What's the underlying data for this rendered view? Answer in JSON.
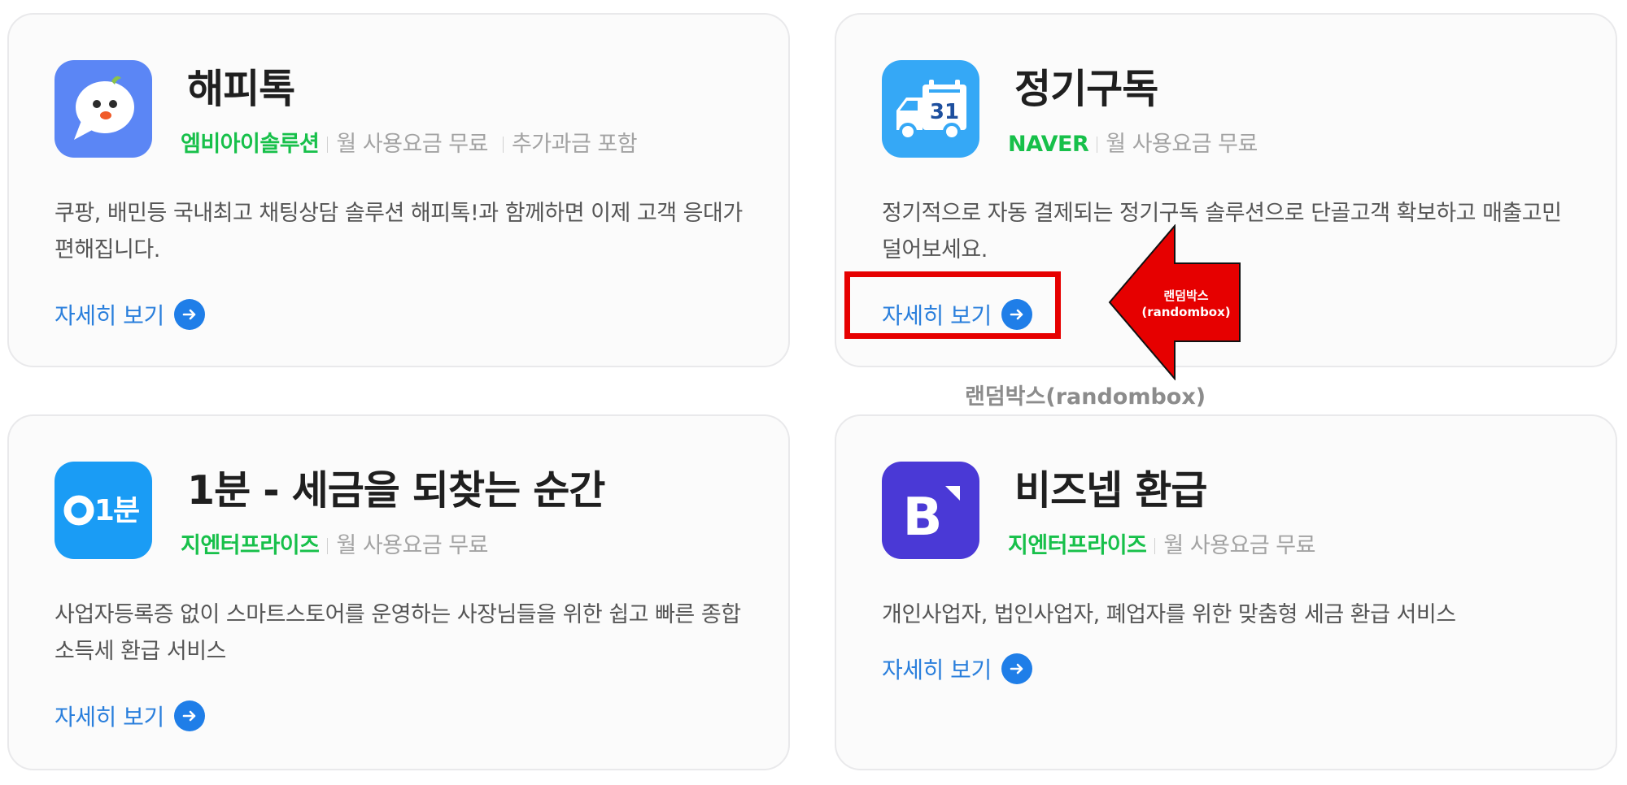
{
  "cards": [
    {
      "title": "해피톡",
      "vendor": "엠비아이솔루션",
      "fee": "월 사용요금 무료",
      "extra": "추가과금 포함",
      "desc": "쿠팡, 배민등 국내최고 채팅상담 솔루션 해피톡!과 함께하면 이제 고객 응대가 편해집니다.",
      "link": "자세히 보기",
      "icon": "chat-bird-icon",
      "icon_color": "#5b86f5"
    },
    {
      "title": "정기구독",
      "vendor": "NAVER",
      "fee": "월 사용요금 무료",
      "desc": "정기적으로 자동 결제되는 정기구독 솔루션으로 단골고객 확보하고 매출고민 덜어보세요.",
      "link": "자세히 보기",
      "icon": "calendar-truck-icon",
      "icon_text": "31",
      "icon_color": "#35a8f6"
    },
    {
      "title": "1분 - 세금을 되찾는 순간",
      "vendor": "지엔터프라이즈",
      "fee": "월 사용요금 무료",
      "desc": "사업자등록증 없이 스마트스토어를 운영하는 사장님들을 위한 쉽고 빠른 종합 소득세 환급 서비스",
      "link": "자세히 보기",
      "icon": "1bun-logo-icon",
      "icon_text": "1분",
      "icon_color": "#1a9cf5"
    },
    {
      "title": "비즈넵 환급",
      "vendor": "지엔터프라이즈",
      "fee": "월 사용요금 무료",
      "desc": "개인사업자, 법인사업자, 폐업자를 위한 맞춤형 세금 환급 서비스",
      "link": "자세히 보기",
      "icon": "biznep-logo-icon",
      "icon_text": "B",
      "icon_color": "#4a39d6"
    }
  ],
  "annotation": {
    "arrow_label_line1": "랜덤박스",
    "arrow_label_line2": "(randombox)",
    "caption": "랜덤박스(randombox)",
    "highlight_color": "#e60000"
  },
  "colors": {
    "vendor_green": "#17c04a",
    "link_blue": "#2a7fdc"
  }
}
